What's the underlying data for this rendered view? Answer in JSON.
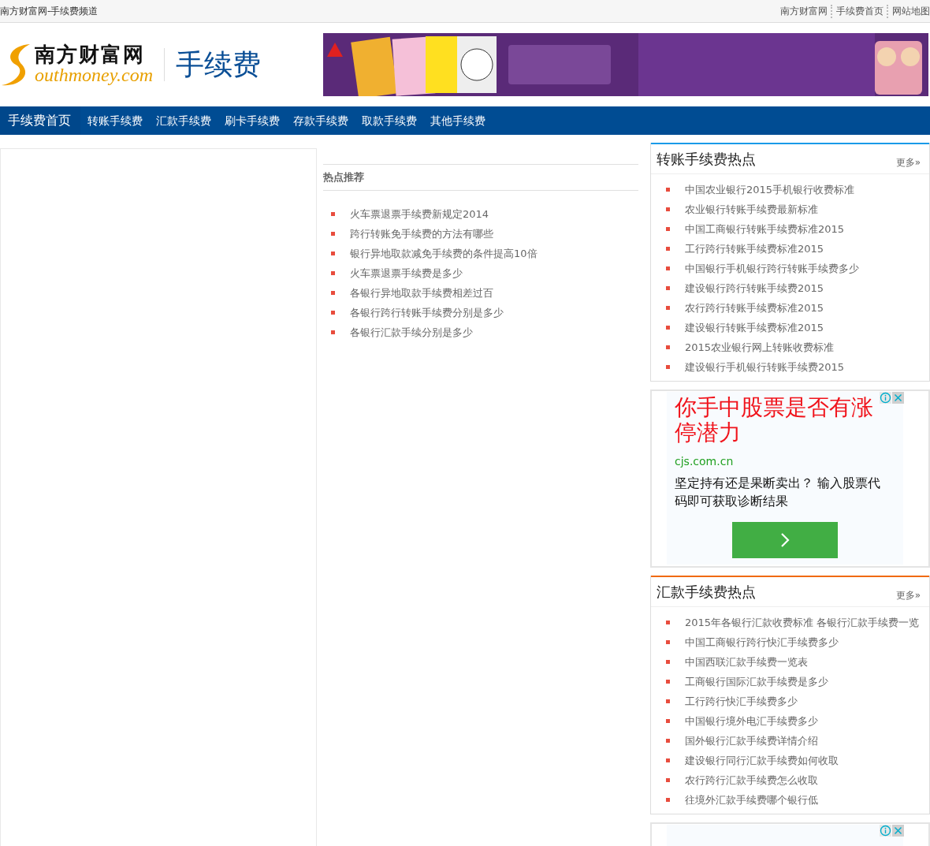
{
  "top_bar": {
    "site_title": "南方财富网-手续费频道",
    "links": [
      "南方财富网",
      "手续费首页",
      "网站地图"
    ]
  },
  "header": {
    "logo_name": "南方财富网",
    "logo_domain": "outhmoney.com",
    "channel": "手续费"
  },
  "nav": [
    {
      "label": "手续费首页",
      "selected": true
    },
    {
      "label": "转账手续费",
      "selected": false
    },
    {
      "label": "汇款手续费",
      "selected": false
    },
    {
      "label": "刷卡手续费",
      "selected": false
    },
    {
      "label": "存款手续费",
      "selected": false
    },
    {
      "label": "取款手续费",
      "selected": false
    },
    {
      "label": "其他手续费",
      "selected": false
    }
  ],
  "hot": {
    "title": "热点推荐",
    "items": [
      "火车票退票手续费新规定2014",
      "跨行转账免手续费的方法有哪些",
      "银行异地取款减免手续费的条件提高10倍",
      "火车票退票手续费是多少",
      "各银行异地取款手续费相差过百",
      "各银行跨行转账手续费分别是多少",
      "各银行汇款手续分别是多少"
    ]
  },
  "sidebar": [
    {
      "kind": "list",
      "title": "转账手续费热点",
      "more": "更多»",
      "color": "#1a9be8",
      "items": [
        "中国农业银行2015手机银行收费标准",
        "农业银行转账手续费最新标准",
        "中国工商银行转账手续费标准2015",
        "工行跨行转账手续费标准2015",
        "中国银行手机银行跨行转账手续费多少",
        "建设银行跨行转账手续费2015",
        "农行跨行转账手续费标准2015",
        "建设银行转账手续费标准2015",
        "2015农业银行网上转账收费标准",
        "建设银行手机银行转账手续费2015"
      ]
    },
    {
      "kind": "ad",
      "title": "你手中股票是否有涨停潜力",
      "url": "cjs.com.cn",
      "text": "坚定持有还是果断卖出？ 输入股票代码即可获取诊断结果"
    },
    {
      "kind": "list",
      "title": "汇款手续费热点",
      "more": "更多»",
      "color": "#f06a0f",
      "items": [
        "2015年各银行汇款收费标准 各银行汇款手续费一览",
        "中国工商银行跨行快汇手续费多少",
        "中国西联汇款手续费一览表",
        "工商银行国际汇款手续费是多少",
        "工行跨行快汇手续费多少",
        "中国银行境外电汇手续费多少",
        "国外银行汇款手续费详情介绍",
        "建设银行同行汇款手续费如何收取",
        "农行跨行汇款手续费怎么收取",
        "往境外汇款手续费哪个银行低"
      ]
    },
    {
      "kind": "ad_cut"
    }
  ]
}
